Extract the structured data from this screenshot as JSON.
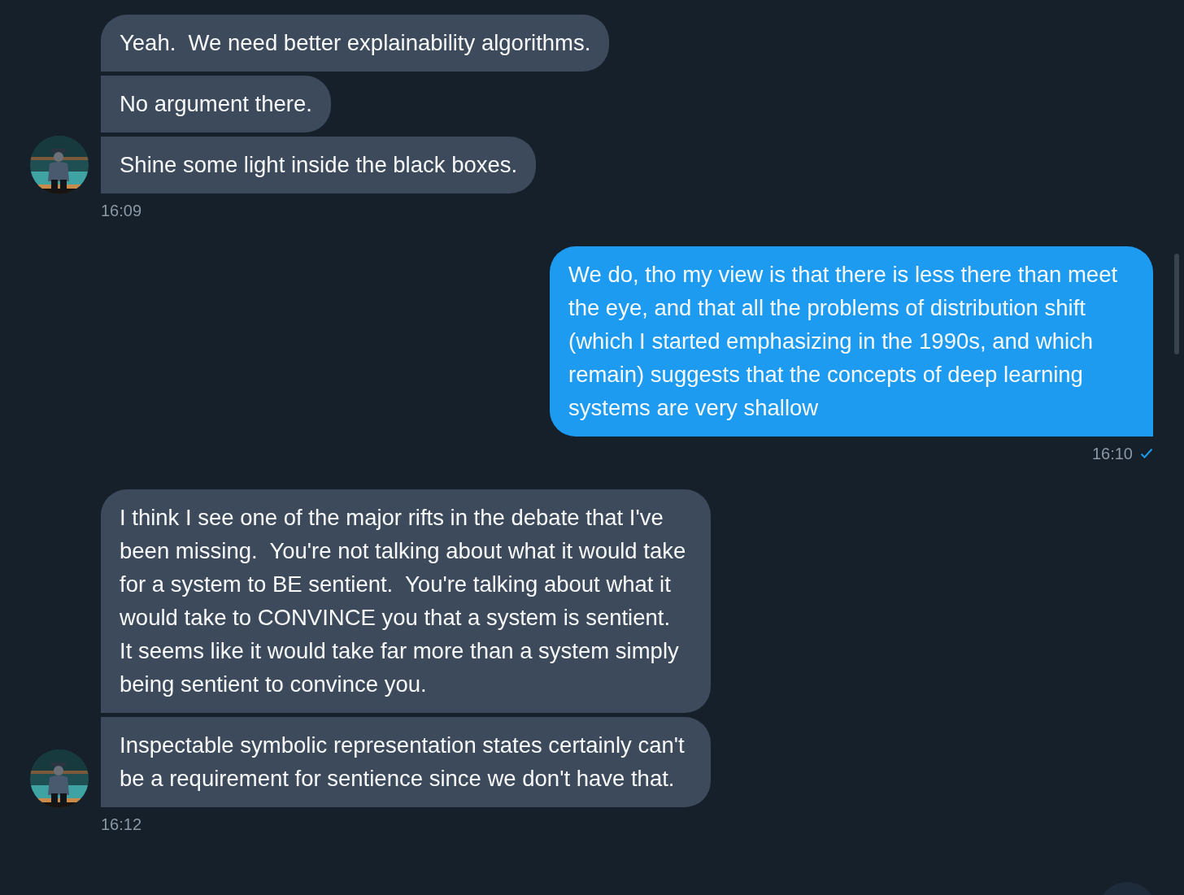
{
  "conversation": [
    {
      "kind": "received",
      "messages": [
        "Yeah.  We need better explainability algorithms.",
        "No argument there.",
        "Shine some light inside the black boxes."
      ],
      "time": "16:09"
    },
    {
      "kind": "sent",
      "messages": [
        "We do, tho my view is that there is less there than meet the eye, and that all the problems of distribution shift (which I started emphasizing in the 1990s, and which remain) suggests that the concepts of deep learning systems are very shallow"
      ],
      "time": "16:10",
      "read": true
    },
    {
      "kind": "received",
      "messages": [
        "I think I see one of the major rifts in the debate that I've been missing.  You're not talking about what it would take for a system to BE sentient.  You're talking about what it would take to CONVINCE you that a system is sentient.  It seems like it would take far more than a system simply being sentient to convince you.",
        "Inspectable symbolic representation states certainly can't be a requirement for sentience since we don't have that."
      ],
      "time": "16:12"
    }
  ]
}
